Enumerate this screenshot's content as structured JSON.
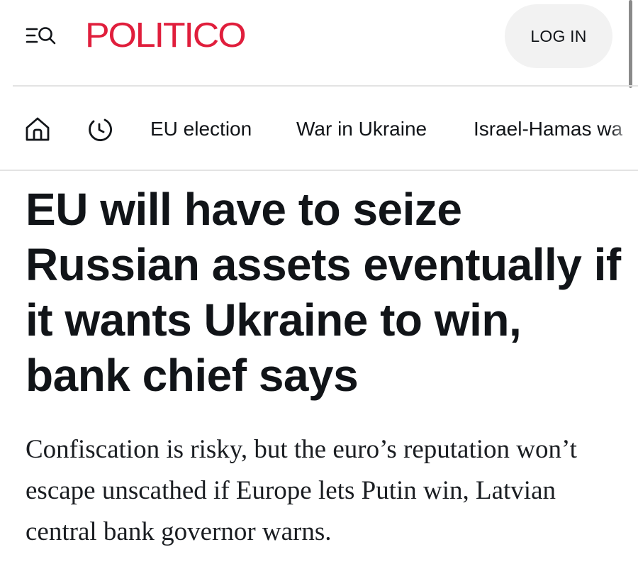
{
  "header": {
    "brand": "POLITICO",
    "login_label": "LOG IN",
    "menu_icon": "menu-search-icon",
    "brand_color": "#e01e3c"
  },
  "nav": {
    "home_icon": "home-icon",
    "latest_icon": "clock-icon",
    "items": [
      {
        "label": "EU election"
      },
      {
        "label": "War in Ukraine"
      },
      {
        "label": "Israel-Hamas wa"
      }
    ]
  },
  "article": {
    "headline": "EU will have to seize Russian assets eventually if it wants Ukraine to win, bank chief says",
    "dek": "Confiscation is risky, but the euro’s reputation won’t escape unscathed if Europe lets Putin win, Latvian central bank governor warns."
  }
}
